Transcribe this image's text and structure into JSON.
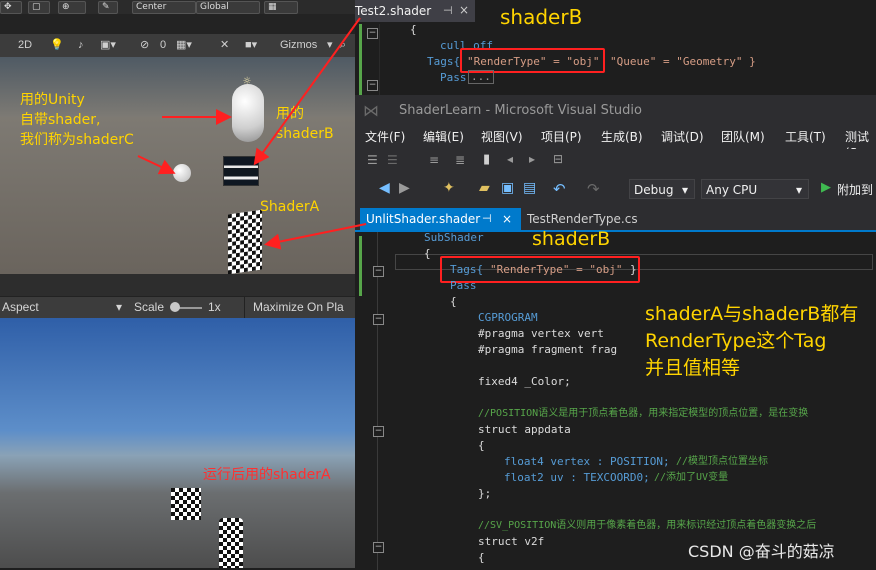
{
  "unity": {
    "top_buttons": [
      "Center",
      "Global"
    ],
    "toolbar": {
      "mode_2d": "2D",
      "hidden_count": "0",
      "gizmos": "Gizmos"
    },
    "annotation_builtin": "用的Unity\n自带shader,\n我们称为shaderC",
    "annotation_shaderB": "用的shaderB",
    "annotation_shaderA": "ShaderA",
    "game_bar": {
      "aspect": "Aspect",
      "scale_label": "Scale",
      "scale_value": "1x",
      "maximize": "Maximize On Pla"
    },
    "annotation_runtime": "运行后用的shaderA"
  },
  "editor_top": {
    "tab": "Test2.shader",
    "label": "shaderB",
    "lines": [
      "{",
      "cull off",
      "Pass"
    ],
    "tags_keyword": "Tags{",
    "tags_rendertype": "\"RenderType\" = \"obj\"",
    "tags_queue": "\"Queue\" = \"Geometry\" }"
  },
  "vs": {
    "title": "ShaderLearn - Microsoft Visual Studio",
    "menu": [
      "文件(F)",
      "编辑(E)",
      "视图(V)",
      "项目(P)",
      "生成(B)",
      "调试(D)",
      "团队(M)",
      "工具(T)",
      "测试(S"
    ],
    "config": "Debug",
    "platform": "Any CPU",
    "attach": "附加到",
    "tabs": {
      "active": "UnlitShader.shader",
      "inactive": "TestRenderType.cs"
    },
    "label": "shaderB",
    "code": {
      "subshader": "SubShader",
      "brace_open": "{",
      "tags_keyword": "Tags{",
      "tags_value": "\"RenderType\" = \"obj\"",
      "tags_close": "}",
      "pass": "Pass",
      "cgprogram": "CGPROGRAM",
      "pragma_vertex": "#pragma vertex vert",
      "pragma_fragment": "#pragma fragment frag",
      "color_decl": "fixed4 _Color;",
      "comment_position": "//POSITION语义是用于顶点着色器，用来指定模型的顶点位置，是在变换",
      "struct_appdata": "struct appdata",
      "vertex_field": "float4 vertex : POSITION;",
      "vertex_comment": "//模型顶点位置坐标",
      "uv_field": "float2 uv : TEXCOORD0;",
      "uv_comment": "//添加了UV变量",
      "brace_close": "};",
      "comment_svposition": "//SV_POSITION语义则用于像素着色器，用来标识经过顶点着色器变换之后",
      "struct_v2f": "struct v2f"
    },
    "explain": [
      "shaderA与shaderB都有",
      "RenderType这个Tag",
      "并且值相等"
    ]
  },
  "watermark": "CSDN @奋斗的菇凉",
  "colors": {
    "annotation_yellow": "#ffd400",
    "annotation_red": "#ff3030",
    "vs_accent": "#007acc"
  }
}
